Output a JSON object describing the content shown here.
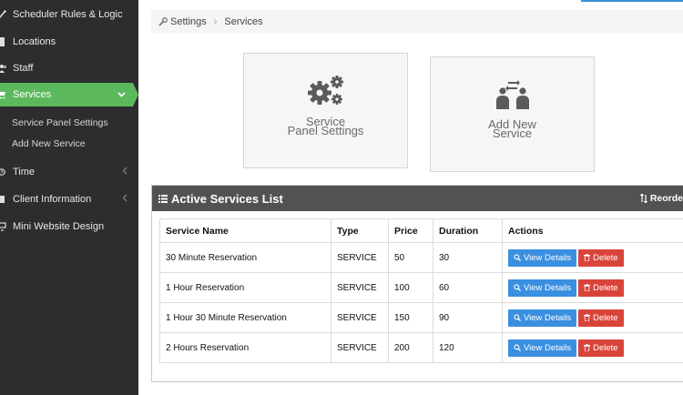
{
  "sidebar": {
    "items": [
      {
        "label": "Scheduler Rules & Logic",
        "icon": "wand-icon"
      },
      {
        "label": "Locations",
        "icon": "building-icon"
      },
      {
        "label": "Staff",
        "icon": "users-icon"
      },
      {
        "label": "Services",
        "icon": "cart-icon",
        "active": true
      },
      {
        "label": "Time",
        "icon": "clock-icon"
      },
      {
        "label": "Client Information",
        "icon": "user-card-icon"
      },
      {
        "label": "Mini Website Design",
        "icon": "desktop-icon"
      }
    ],
    "sub_items": [
      "Service Panel Settings",
      "Add New Service"
    ],
    "active_color": "#5cb85c"
  },
  "breadcrumb": {
    "items": [
      "Settings",
      "Services"
    ]
  },
  "tiles": {
    "panel_settings": {
      "line1": "Service",
      "line2": "Panel Settings"
    },
    "add_service": {
      "line1": "Add New",
      "line2": "Service"
    }
  },
  "panel": {
    "title": "Active Services List",
    "reorder_label": "Reorde"
  },
  "table": {
    "headers": [
      "Service Name",
      "Type",
      "Price",
      "Duration",
      "Actions"
    ],
    "rows": [
      {
        "name": "30 Minute Reservation",
        "type": "SERVICE",
        "price": "50",
        "duration": "30"
      },
      {
        "name": "1 Hour Reservation",
        "type": "SERVICE",
        "price": "100",
        "duration": "60"
      },
      {
        "name": "1 Hour 30 Minute Reservation",
        "type": "SERVICE",
        "price": "150",
        "duration": "90"
      },
      {
        "name": "2 Hours Reservation",
        "type": "SERVICE",
        "price": "200",
        "duration": "120"
      }
    ],
    "view_label": "View Details",
    "delete_label": "Delete"
  }
}
